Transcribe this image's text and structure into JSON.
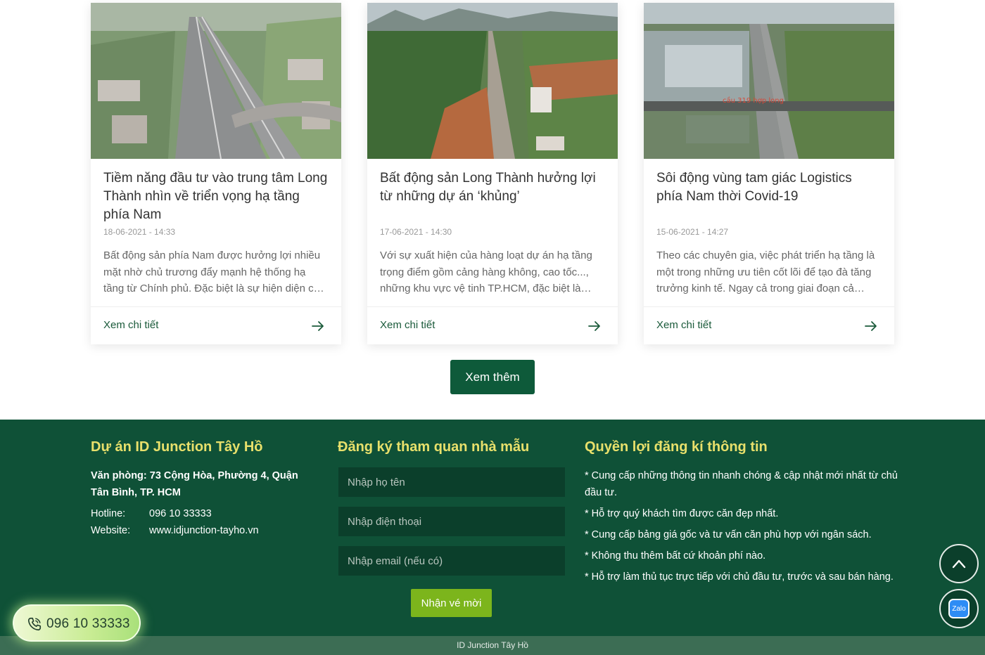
{
  "articles": [
    {
      "title": "Tiềm năng đầu tư vào trung tâm Long Thành nhìn về triển vọng hạ tầng phía Nam",
      "date": "18-06-2021 - 14:33",
      "excerpt": "Bất động sản phía Nam được hưởng lợi nhiều mặt nhờ chủ trương đẩy mạnh hệ thống hạ tầng từ Chính phủ. Đặc biệt là sự hiện diện của sân bay quốc tế Long Thành",
      "link_label": "Xem chi tiết"
    },
    {
      "title": "Bất động sản Long Thành hưởng lợi từ những dự án ‘khủng’",
      "date": "17-06-2021 - 14:30",
      "excerpt": "Với sự xuất hiện của hàng loạt dự án hạ tầng trọng điểm gồm cảng hàng không, cao tốc..., những khu vực vệ tinh TP.HCM, đặc biệt là huyện Long Thành",
      "link_label": "Xem chi tiết"
    },
    {
      "title": "Sôi động vùng tam giác Logistics phía Nam thời Covid-19",
      "date": "15-06-2021 - 14:27",
      "excerpt": "Theo các chuyên gia, việc phát triển hạ tầng là một trong những ưu tiên cốt lõi để tạo đà tăng trưởng kinh tế. Ngay cả trong giai đoạn cả nước",
      "link_label": "Xem chi tiết",
      "image_caption": "cầu 319 hợp long"
    }
  ],
  "load_more_label": "Xem thêm",
  "footer": {
    "col1": {
      "title": "Dự án ID Junction Tây Hồ",
      "office": "Văn phòng: 73 Cộng Hòa, Phường 4, Quận Tân Bình, TP. HCM",
      "hotline_label": "Hotline:",
      "hotline_value": "096 10 33333",
      "website_label": "Website:",
      "website_value": "www.idjunction-tayho.vn"
    },
    "col2": {
      "title": "Đăng ký tham quan nhà mẫu",
      "name_placeholder": "Nhập họ tên",
      "phone_placeholder": "Nhập điện thoại",
      "email_placeholder": "Nhập email (nếu có)",
      "submit_label": "Nhận vé mời"
    },
    "col3": {
      "title": "Quyền lợi đăng kí thông tin",
      "benefits": [
        "* Cung cấp những thông tin nhanh chóng & cập nhật mới nhất từ chủ đầu tư.",
        "* Hỗ trợ quý khách tìm được căn đẹp nhất.",
        "* Cung cấp bảng giá gốc và tư vấn căn phù hợp với ngân sách.",
        "* Không thu thêm bất cứ khoản phí nào.",
        "* Hỗ trợ làm thủ tục trực tiếp với chủ đầu tư, trước và sau bán hàng."
      ]
    },
    "copyright": "ID Junction Tây Hồ"
  },
  "floating": {
    "hotline_number": "096 10 33333",
    "zalo_label": "Zalo"
  },
  "colors": {
    "footer_bg": "#0f5137",
    "accent_yellow": "#e8e06b",
    "button_green": "#0e5a3a",
    "submit_green": "#7cb51c"
  }
}
